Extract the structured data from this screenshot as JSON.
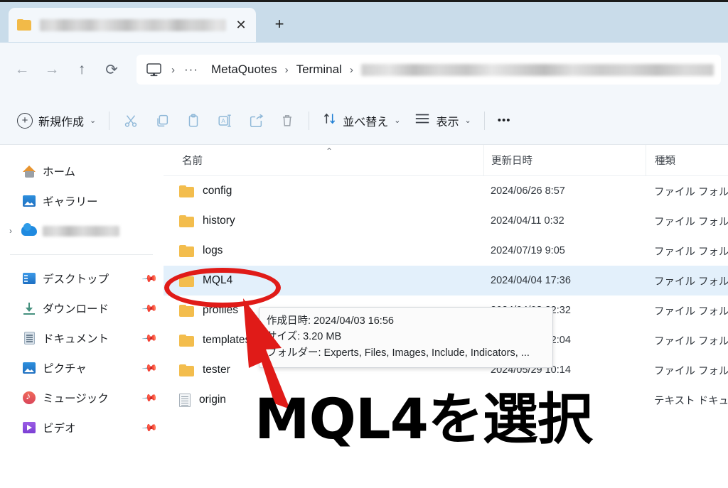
{
  "window": {
    "tab": {
      "title_redacted": true,
      "folder_icon": "folder-icon",
      "close_label": "✕"
    },
    "new_tab_label": "+"
  },
  "nav": {
    "back_label": "←",
    "forward_label": "→",
    "up_label": "↑",
    "refresh_label": "⟳",
    "breadcrumb": {
      "root_icon": "monitor-icon",
      "overflow_label": "···",
      "separator": "›",
      "items": [
        "MetaQuotes",
        "Terminal"
      ],
      "last_redacted": true
    }
  },
  "toolbar": {
    "new_label": "新規作成",
    "new_chevron": "⌄",
    "cut_icon": "scissors-icon",
    "copy_icon": "copy-icon",
    "paste_icon": "paste-icon",
    "rename_icon": "rename-icon",
    "share_icon": "share-icon",
    "delete_icon": "trash-icon",
    "sort_label": "並べ替え",
    "sort_chevron": "⌄",
    "view_label": "表示",
    "view_chevron": "⌄",
    "more_label": "•••"
  },
  "sidebar": {
    "items": [
      {
        "label": "ホーム",
        "icon": "home-icon",
        "pinned": false,
        "expandable": false,
        "redacted": false
      },
      {
        "label": "ギャラリー",
        "icon": "gallery-icon",
        "pinned": false,
        "expandable": false,
        "redacted": false
      },
      {
        "label": "",
        "icon": "onedrive-icon",
        "pinned": false,
        "expandable": true,
        "redacted": true
      },
      {
        "label": "デスクトップ",
        "icon": "desktop-icon",
        "pinned": true,
        "expandable": false,
        "redacted": false
      },
      {
        "label": "ダウンロード",
        "icon": "download-icon",
        "pinned": true,
        "expandable": false,
        "redacted": false
      },
      {
        "label": "ドキュメント",
        "icon": "documents-icon",
        "pinned": true,
        "expandable": false,
        "redacted": false
      },
      {
        "label": "ピクチャ",
        "icon": "pictures-icon",
        "pinned": true,
        "expandable": false,
        "redacted": false
      },
      {
        "label": "ミュージック",
        "icon": "music-icon",
        "pinned": true,
        "expandable": false,
        "redacted": false
      },
      {
        "label": "ビデオ",
        "icon": "videos-icon",
        "pinned": true,
        "expandable": false,
        "redacted": false
      }
    ],
    "pin_glyph": "📌"
  },
  "filelist": {
    "columns": {
      "name": "名前",
      "date": "更新日時",
      "type": "種類"
    },
    "sort_caret": "⌃",
    "rows": [
      {
        "name": "config",
        "date": "2024/06/26 8:57",
        "type": "ファイル フォルダ",
        "icon": "folder-icon",
        "selected": false
      },
      {
        "name": "history",
        "date": "2024/04/11 0:32",
        "type": "ファイル フォルダ",
        "icon": "folder-icon",
        "selected": false
      },
      {
        "name": "logs",
        "date": "2024/07/19 9:05",
        "type": "ファイル フォルダ",
        "icon": "folder-icon",
        "selected": false
      },
      {
        "name": "MQL4",
        "date": "2024/04/04 17:36",
        "type": "ファイル フォルダ",
        "icon": "folder-icon",
        "selected": true
      },
      {
        "name": "profiles",
        "date": "2024/04/03 22:32",
        "type": "ファイル フォルダ",
        "icon": "folder-icon",
        "selected": false
      },
      {
        "name": "templates",
        "date": "2024/04/03 22:04",
        "type": "ファイル フォルダ",
        "icon": "folder-icon",
        "selected": false
      },
      {
        "name": "tester",
        "date": "2024/05/29 10:14",
        "type": "ファイル フォルダ",
        "icon": "folder-icon",
        "selected": false
      },
      {
        "name": "origin",
        "date": "",
        "type": "テキスト ドキュ",
        "icon": "text-file-icon",
        "selected": false
      }
    ]
  },
  "tooltip": {
    "created_line": "作成日時: 2024/04/03 16:56",
    "size_line": "サイズ: 3.20 MB",
    "folders_line": "フォルダー: Experts, Files, Images, Include, Indicators, ..."
  },
  "annotations": {
    "callout_text": "MQL4を選択",
    "highlight_color": "#e01b18",
    "ellipse_target": "MQL4",
    "arrow_color": "#e01b18"
  },
  "colors": {
    "titlebar": "#c9dcea",
    "chrome": "#f3f7fb",
    "selection": "#e3f0fb",
    "folder": "#f3bd4d",
    "accent_red": "#e01b18"
  }
}
